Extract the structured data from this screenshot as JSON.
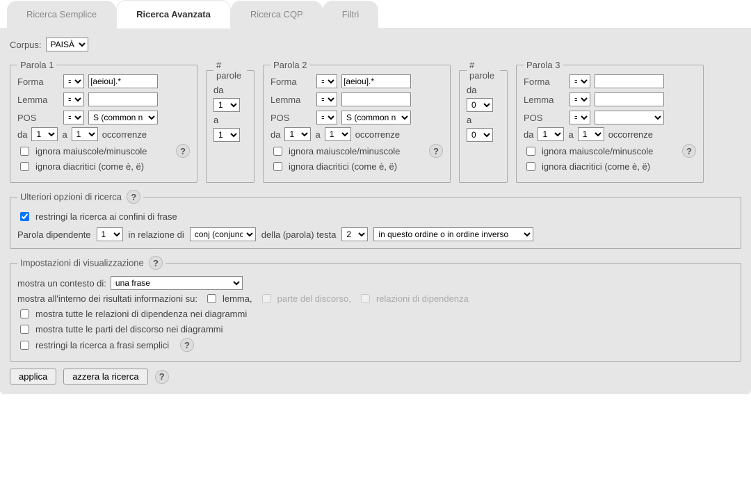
{
  "tabs": {
    "items": [
      "Ricerca Semplice",
      "Ricerca Avanzata",
      "Ricerca CQP",
      "Filtri"
    ],
    "active": 1
  },
  "corpus": {
    "label": "Corpus:",
    "value": "PAISÀ"
  },
  "parola1": {
    "legend": "Parola 1",
    "forma": {
      "label": "Forma",
      "op": "=",
      "value": "[aeiou].*"
    },
    "lemma": {
      "label": "Lemma",
      "op": "=",
      "value": ""
    },
    "pos": {
      "label": "POS",
      "op": "=",
      "value": "S (common n"
    },
    "occ": {
      "da_label": "da",
      "da": "1",
      "a_label": "a",
      "a": "1",
      "suffix": "occorrenze"
    },
    "ignore_case": {
      "label": "ignora maiuscole/minuscole",
      "checked": false
    },
    "ignore_diac": {
      "label": "ignora diacritici (come è, ë)",
      "checked": false
    }
  },
  "nparole1": {
    "legend": "# parole",
    "da_label": "da",
    "da": "1",
    "a_label": "a",
    "a": "1"
  },
  "parola2": {
    "legend": "Parola 2",
    "forma": {
      "label": "Forma",
      "op": "=",
      "value": "[aeiou].*"
    },
    "lemma": {
      "label": "Lemma",
      "op": "=",
      "value": ""
    },
    "pos": {
      "label": "POS",
      "op": "=",
      "value": "S (common n"
    },
    "occ": {
      "da_label": "da",
      "da": "1",
      "a_label": "a",
      "a": "1",
      "suffix": "occorrenze"
    },
    "ignore_case": {
      "label": "ignora maiuscole/minuscole",
      "checked": false
    },
    "ignore_diac": {
      "label": "ignora diacritici (come è, ë)",
      "checked": false
    }
  },
  "nparole2": {
    "legend": "# parole",
    "da_label": "da",
    "da": "0",
    "a_label": "a",
    "a": "0"
  },
  "parola3": {
    "legend": "Parola 3",
    "forma": {
      "label": "Forma",
      "op": "=",
      "value": ""
    },
    "lemma": {
      "label": "Lemma",
      "op": "=",
      "value": ""
    },
    "pos": {
      "label": "POS",
      "op": "=",
      "value": ""
    },
    "occ": {
      "da_label": "da",
      "da": "1",
      "a_label": "a",
      "a": "1",
      "suffix": "occorrenze"
    },
    "ignore_case": {
      "label": "ignora maiuscole/minuscole",
      "checked": false
    },
    "ignore_diac": {
      "label": "ignora diacritici (come è, ë)",
      "checked": false
    }
  },
  "ulteriori": {
    "legend": "Ulteriori opzioni di ricerca",
    "restrict_sentence": {
      "label": "restringi la ricerca ai confini di frase",
      "checked": true
    },
    "dep": {
      "pre": "Parola dipendente",
      "dep_val": "1",
      "rel_pre": "in relazione di",
      "rel_val": "conj (conjunc",
      "head_pre": "della (parola) testa",
      "head_val": "2",
      "order_val": "in questo ordine o in ordine inverso"
    }
  },
  "visual": {
    "legend": "Impostazioni di visualizzazione",
    "context": {
      "label": "mostra un contesto di:",
      "value": "una frase"
    },
    "info_pre": "mostra all'interno dei risultati informazioni su:",
    "info_lemma": "lemma,",
    "info_pos": "parte del discorso,",
    "info_dep": "relazioni di dipendenza",
    "show_dep_diag": {
      "label": "mostra tutte le relazioni di dipendenza nei diagrammi",
      "checked": false
    },
    "show_pos_diag": {
      "label": "mostra tutte le parti del discorso nei diagrammi",
      "checked": false
    },
    "simple_phrases": {
      "label": "restringi la ricerca a frasi semplici",
      "checked": false
    }
  },
  "actions": {
    "apply": "applica",
    "reset": "azzera la ricerca"
  },
  "help_glyph": "?"
}
